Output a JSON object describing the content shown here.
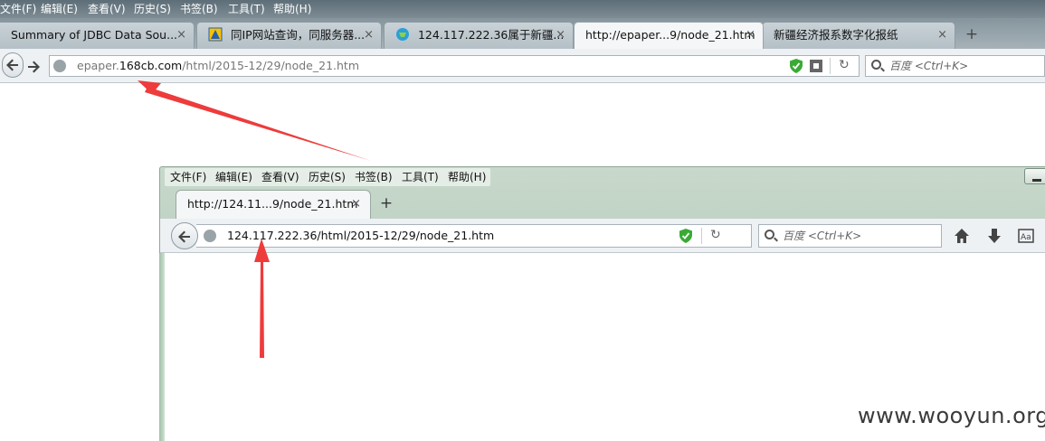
{
  "outer_browser": {
    "menu": [
      "文件(F)",
      "编辑(E)",
      "查看(V)",
      "历史(S)",
      "书签(B)",
      "工具(T)",
      "帮助(H)"
    ],
    "tabs": [
      {
        "label": "Summary of JDBC Data Sou..."
      },
      {
        "label": "同IP网站查询，同服务器..."
      },
      {
        "label": "124.117.222.36属于新疆..."
      },
      {
        "label": "http://epaper...9/node_21.htm"
      },
      {
        "label": "新疆经济报系数字化报纸"
      }
    ],
    "tab_close_glyph": "×",
    "new_tab_glyph": "+",
    "url": {
      "prefix": "epaper.",
      "host": "168cb.com",
      "path": "/html/2015-12/29/node_21.htm"
    },
    "search_placeholder": "百度 <Ctrl+K>"
  },
  "inner_browser": {
    "menu": [
      "文件(F)",
      "编辑(E)",
      "查看(V)",
      "历史(S)",
      "书签(B)",
      "工具(T)",
      "帮助(H)"
    ],
    "tab": {
      "label": "http://124.11...9/node_21.htm"
    },
    "tab_close_glyph": "×",
    "new_tab_glyph": "+",
    "url": "124.117.222.36/html/2015-12/29/node_21.htm",
    "search_placeholder": "百度 <Ctrl+K>"
  },
  "watermark": "www.wooyun.org",
  "colors": {
    "arrow": "#ee3b3b",
    "shield": "#3aaa35"
  }
}
